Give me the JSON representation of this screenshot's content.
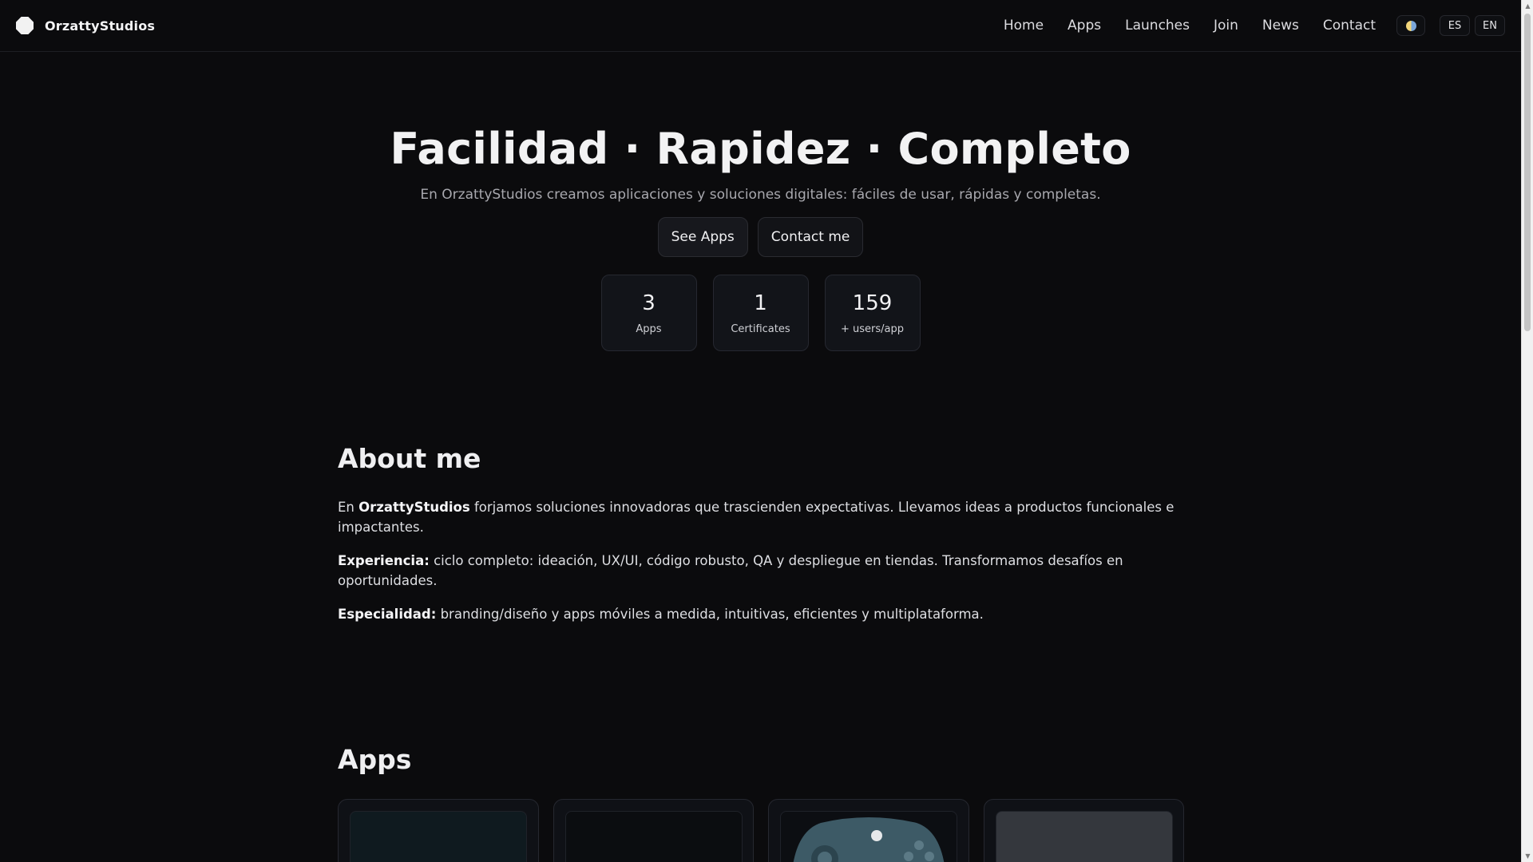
{
  "header": {
    "brand": "OrzattyStudios",
    "nav": [
      "Home",
      "Apps",
      "Launches",
      "Join",
      "News",
      "Contact"
    ],
    "languages": [
      "ES",
      "EN"
    ]
  },
  "hero": {
    "title": "Facilidad · Rapidez · Completo",
    "subtitle": "En OrzattyStudios creamos aplicaciones y soluciones digitales: fáciles de usar, rápidas y completas.",
    "primary_button": "See Apps",
    "secondary_button": "Contact me",
    "stats": [
      {
        "value": "3",
        "label": "Apps"
      },
      {
        "value": "1",
        "label": "Certificates"
      },
      {
        "value": "159",
        "label": "+ users/app"
      }
    ]
  },
  "about": {
    "title": "About me",
    "p1_pre": "En ",
    "p1_bold": "OrzattyStudios",
    "p1_post": " forjamos soluciones innovadoras que trascienden expectativas. Llevamos ideas a productos funcionales e impactantes.",
    "p2_bold": "Experiencia:",
    "p2_post": " ciclo completo: ideación, UX/UI, código robusto, QA y despliegue en tiendas. Transformamos desafíos en oportunidades.",
    "p3_bold": "Especialidad:",
    "p3_post": " branding/diseño y apps móviles a medida, intuitivas, eficientes y multiplataforma."
  },
  "apps": {
    "title": "Apps"
  },
  "colors": {
    "background": "#0b0b0d",
    "card": "#121419",
    "border": "#262830",
    "controller": "#3d5a66"
  }
}
